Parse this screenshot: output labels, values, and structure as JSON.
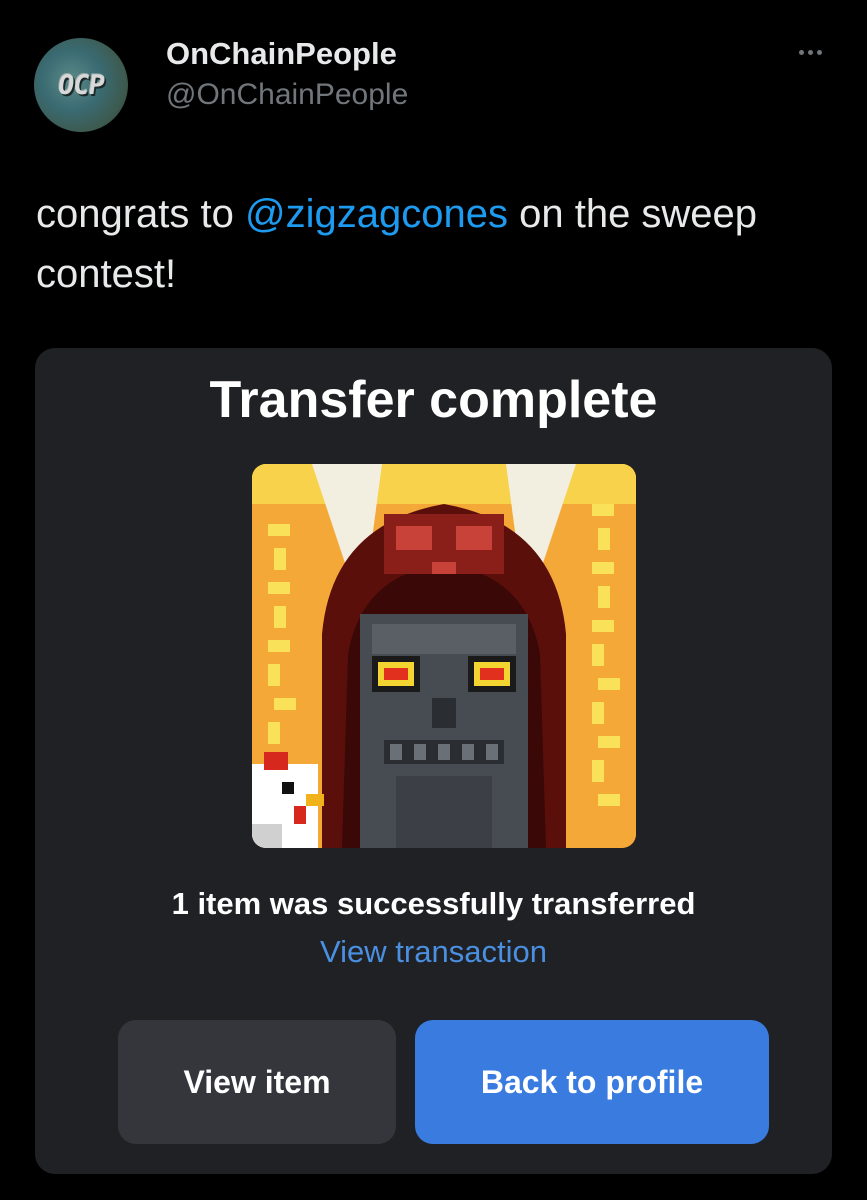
{
  "author": {
    "display_name": "OnChainPeople",
    "handle": "@OnChainPeople",
    "avatar_text": "OCP"
  },
  "tweet": {
    "text_before": "congrats to ",
    "mention": "@zigzagcones",
    "text_after": " on the sweep contest!"
  },
  "card": {
    "title": "Transfer complete",
    "success_message": "1 item was successfully transferred",
    "view_transaction_label": "View transaction",
    "view_item_label": "View item",
    "back_to_profile_label": "Back to profile"
  },
  "icons": {
    "more": "more-horizontal-icon"
  },
  "colors": {
    "background": "#000000",
    "card": "#202125",
    "link": "#1d9bf0",
    "primary_button": "#3a7be0",
    "secondary_button": "#35363b"
  }
}
